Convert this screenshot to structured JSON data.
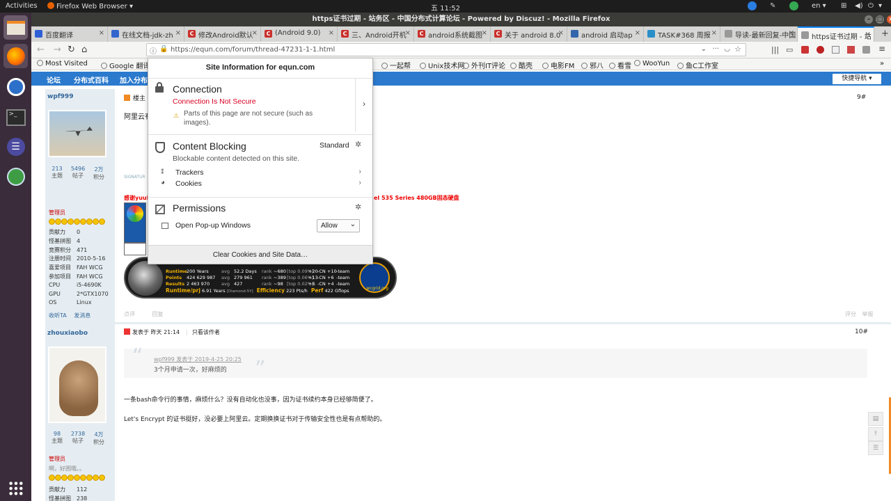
{
  "system": {
    "activities": "Activities",
    "app_menu": "Firefox Web Browser ▾",
    "clock": "五 11:52",
    "lang": "en ▾"
  },
  "window": {
    "title": "https证书过期 - 站务区 - 中国分布式计算论坛 - Powered by Discuz! - Mozilla Firefox"
  },
  "tabs": [
    {
      "label": "百度翻译",
      "icon": "baidu-icon",
      "color": "#2f5fd6"
    },
    {
      "label": "在线文档-jdk-zh",
      "icon": "settings-icon",
      "color": "#3366cc"
    },
    {
      "label": "修改Android默认",
      "icon": "csdn-icon",
      "color": "#c9302c"
    },
    {
      "label": "(Android 9.0)",
      "icon": "csdn-icon",
      "color": "#c9302c"
    },
    {
      "label": "三、Android开机",
      "icon": "csdn-icon",
      "color": "#c9302c"
    },
    {
      "label": "android系统截图",
      "icon": "csdn-icon",
      "color": "#c9302c"
    },
    {
      "label": "关于 android 8.0",
      "icon": "csdn-icon",
      "color": "#c9302c"
    },
    {
      "label": "android 启动ap",
      "icon": "blog-icon",
      "color": "#3366aa"
    },
    {
      "label": "TASK#368 周报",
      "icon": "globe-icon",
      "color": "#2a8fc9"
    },
    {
      "label": "导读-最新回复-中国",
      "icon": "blank-icon",
      "color": "#999999"
    },
    {
      "label": "https证书过期 - 站",
      "icon": "blank-icon",
      "color": "#999999"
    }
  ],
  "nav": {
    "url": "https://equn.com/forum/thread-47231-1-1.html"
  },
  "bookmarks": [
    {
      "label": "Most Visited",
      "icon": "gear-icon"
    },
    {
      "label": "Google 翻译",
      "icon": "translate-icon"
    },
    {
      "label": "tats",
      "icon": "blank-icon"
    },
    {
      "label": "BAM!",
      "icon": "chart-icon"
    },
    {
      "label": "Vultr",
      "icon": "v-icon"
    },
    {
      "label": "Linode",
      "icon": "linode-icon"
    },
    {
      "label": "cnzz",
      "icon": "globe-icon"
    },
    {
      "label": "一起帮",
      "icon": "globe-icon"
    },
    {
      "label": "Unix技术网",
      "icon": "globe-icon"
    },
    {
      "label": "外刊IT评论",
      "icon": "globe-icon"
    },
    {
      "label": "酷壳",
      "icon": "img-icon"
    },
    {
      "label": "电影FM",
      "icon": "globe-icon"
    },
    {
      "label": "邪八",
      "icon": "globe-icon"
    },
    {
      "label": "看雪",
      "icon": "globe-icon"
    },
    {
      "label": "WooYun",
      "icon": "globe-icon"
    },
    {
      "label": "鱼C工作室",
      "icon": "globe-icon"
    }
  ],
  "forum": {
    "nav": [
      "论坛",
      "分布式百科",
      "加入分布"
    ],
    "quicknav": "快捷导航 ▾",
    "post1": {
      "author": "wpf999",
      "floor_label": "楼主",
      "floor": "9#",
      "preview": "阿里云有",
      "stats": [
        {
          "v": "213",
          "l": "主题"
        },
        {
          "v": "5496",
          "l": "帖子"
        },
        {
          "v": "2万",
          "l": "积分"
        }
      ],
      "group": "管理员",
      "profile": [
        {
          "k": "贡献力",
          "v": "0"
        },
        {
          "k": "怪基拼图",
          "v": "4"
        },
        {
          "k": "竞赛积分",
          "v": "471"
        },
        {
          "k": "注册时间",
          "v": "2010-5-16"
        },
        {
          "k": "喜爱项目",
          "v": "FAH WCG"
        },
        {
          "k": "参加项目",
          "v": "FAH WCG"
        },
        {
          "k": "CPU",
          "v": "i5-4690K"
        },
        {
          "k": "GPU",
          "v": "2*GTX1070"
        },
        {
          "k": "OS",
          "v": "Linux"
        }
      ],
      "actions": [
        "收听TA",
        "发消息"
      ],
      "signature_label": "SIGNATUR",
      "thanks_prefix": "感谢yuuk",
      "thanks_suffix": "el 535 Series 480GB固态硬盘",
      "footer_actions": [
        "点评",
        "回复"
      ],
      "footer_right": [
        "评分",
        "举报"
      ],
      "banner": {
        "rows": [
          [
            "Runtime",
            "200 Years",
            "avg",
            "52.2 Days",
            "rank",
            "~680",
            "[top 0.09%]",
            "+20",
            "-CN",
            "+10",
            "-team"
          ],
          [
            "Points",
            "424 629 987",
            "avg",
            "279 961",
            "rank",
            "~389",
            "[top 0.06%]",
            "+13",
            "-CN",
            "+6",
            "-team"
          ],
          [
            "Results",
            "2 463 970",
            "avg",
            "427",
            "rank",
            "~98",
            "[top 0.02%]",
            "+6",
            "-CN",
            "+4",
            "-team"
          ]
        ],
        "runtime_prj_label": "Runtime/prj",
        "runtime_prj_value": "6.91 Years",
        "diamond": "[Diamond-5Y]",
        "efficiency_label": "Efficiency",
        "efficiency_value": "223 Pts/h",
        "perf_label": "Perf",
        "perf_value": "422 Gflops",
        "site": "wcgrid.org"
      }
    },
    "post2": {
      "author": "zhouxiaobo",
      "posted": "发表于 昨天 21:14",
      "only_author": "只看该作者",
      "floor": "10#",
      "quote_meta": "wpf999 发表于 2019-4-25 20:25",
      "quote_text": "3个月申请一次，好麻烦的",
      "body1": "一条bash命令行的事情，麻烦什么？没有自动化也没事，因为证书续约本身已经够简便了。",
      "body2": "Let's Encrypt 的证书挺好，没必要上阿里云。定期换换证书对于传输安全性也是有点帮助的。",
      "stats": [
        {
          "v": "98",
          "l": "主题"
        },
        {
          "v": "2738",
          "l": "帖子"
        },
        {
          "v": "4万",
          "l": "积分"
        }
      ],
      "group": "管理员",
      "motto": "啊，好困哦。。",
      "profile": [
        {
          "k": "贡献力",
          "v": "112"
        },
        {
          "k": "怪基拼图",
          "v": "238"
        }
      ]
    }
  },
  "popup": {
    "title": "Site Information for equn.com",
    "connection": {
      "heading": "Connection",
      "status": "Connection Is Not Secure",
      "note": "Parts of this page are not secure (such as images)."
    },
    "blocking": {
      "heading": "Content Blocking",
      "mode": "Standard",
      "desc": "Blockable content detected on this site.",
      "trackers": "Trackers",
      "cookies": "Cookies"
    },
    "permissions": {
      "heading": "Permissions",
      "popups": "Open Pop-up Windows",
      "popups_value": "Allow"
    },
    "clear": "Clear Cookies and Site Data…"
  }
}
